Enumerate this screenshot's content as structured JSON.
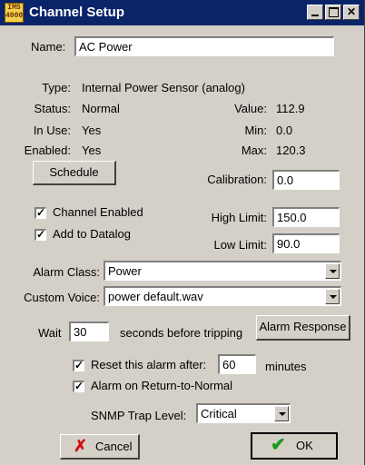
{
  "window": {
    "logo_text": "IMS\n4000",
    "title": "Channel Setup"
  },
  "name": {
    "label": "Name:",
    "value": "AC Power"
  },
  "info": {
    "type_label": "Type:",
    "type_value": "Internal Power Sensor (analog)",
    "status_label": "Status:",
    "status_value": "Normal",
    "inuse_label": "In Use:",
    "inuse_value": "Yes",
    "enabled_label": "Enabled:",
    "enabled_value": "Yes",
    "value_label": "Value:",
    "value_value": "112.9",
    "min_label": "Min:",
    "min_value": "0.0",
    "max_label": "Max:",
    "max_value": "120.3"
  },
  "schedule_button": "Schedule",
  "calibration": {
    "label": "Calibration:",
    "value": "0.0"
  },
  "channel_enabled": {
    "label": "Channel Enabled",
    "checked": "✓"
  },
  "add_to_datalog": {
    "label": "Add to Datalog",
    "checked": "✓"
  },
  "high_limit": {
    "label": "High Limit:",
    "value": "150.0"
  },
  "low_limit": {
    "label": "Low Limit:",
    "value": "90.0"
  },
  "alarm_class": {
    "label": "Alarm Class:",
    "value": "Power"
  },
  "custom_voice": {
    "label": "Custom Voice:",
    "value": "power default.wav"
  },
  "wait": {
    "label": "Wait",
    "value": "30",
    "suffix": "seconds before tripping"
  },
  "alarm_response_button": "Alarm Response",
  "reset_alarm": {
    "label": "Reset this alarm after:",
    "value": "60",
    "suffix": "minutes",
    "checked": "✓"
  },
  "alarm_return": {
    "label": "Alarm on Return-to-Normal",
    "checked": "✓"
  },
  "snmp": {
    "label": "SNMP Trap Level:",
    "value": "Critical"
  },
  "cancel_button": "Cancel",
  "ok_button": "OK",
  "colors": {
    "titlebar": "#0a246a",
    "face": "#d4d0c8",
    "cancel_icon": "#d01010",
    "ok_icon": "#1a9a1a"
  }
}
